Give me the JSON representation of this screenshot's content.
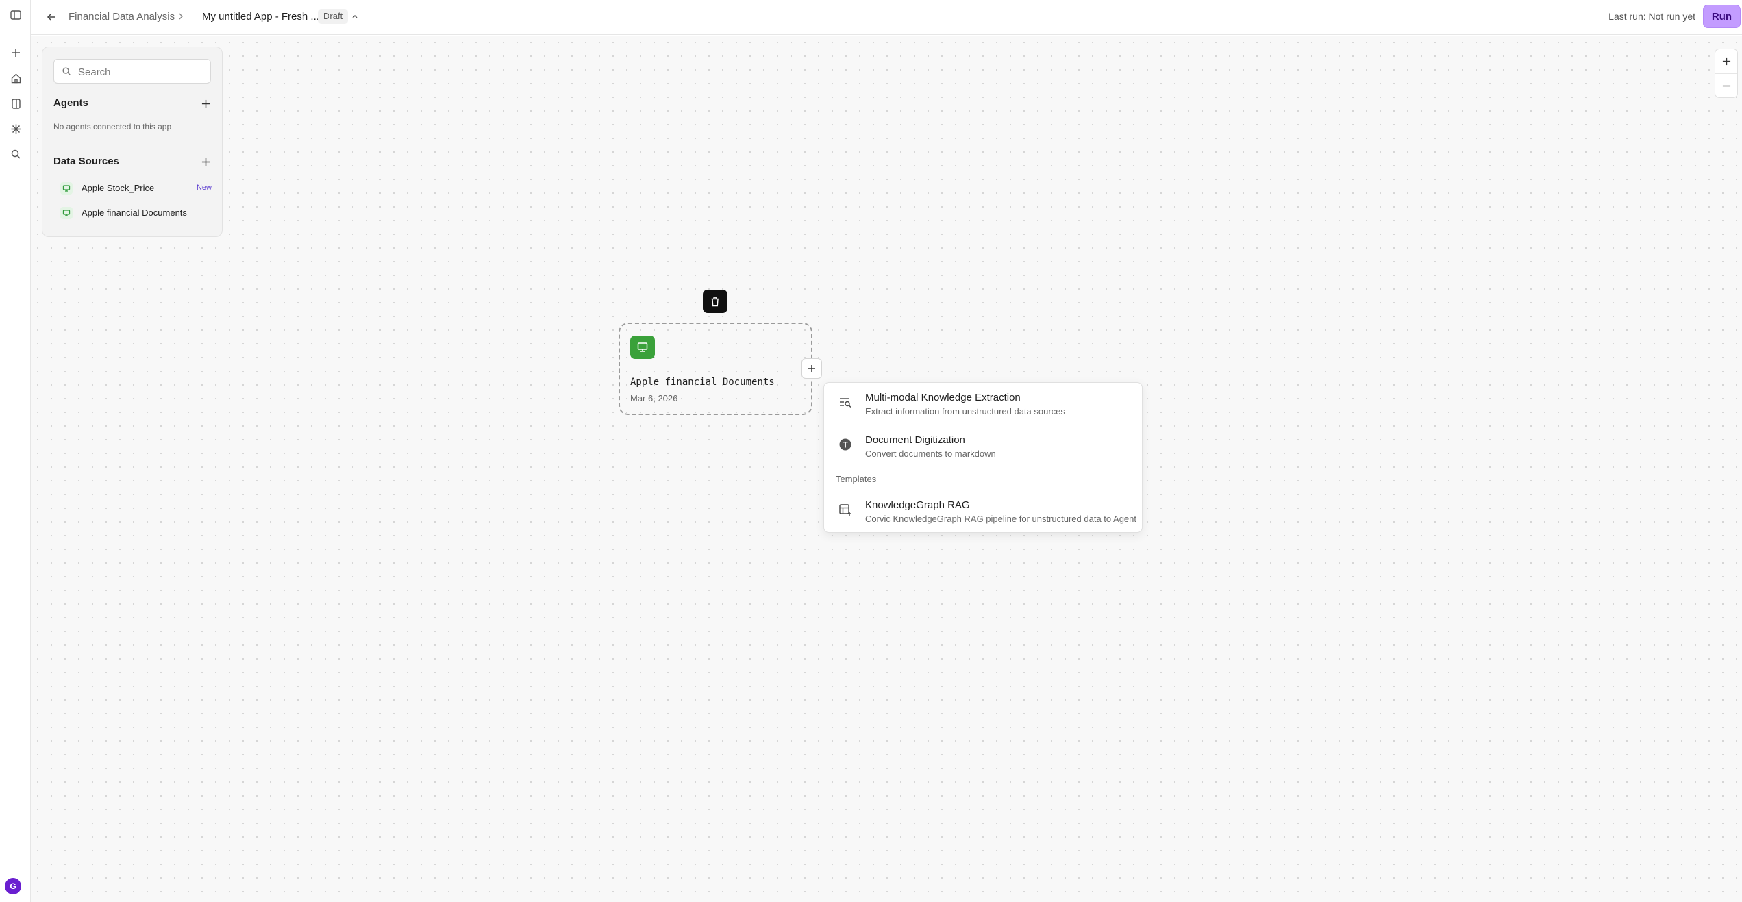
{
  "rail": {
    "avatar_initial": "G",
    "icons": [
      "sidebar-toggle-icon",
      "plus-icon",
      "home-icon",
      "book-icon",
      "asterisk-icon",
      "search-icon"
    ]
  },
  "header": {
    "breadcrumb_parent": "Financial Data Analysis",
    "app_title": "My untitled App - Fresh ...",
    "status_badge": "Draft",
    "last_run": "Last run: Not run yet",
    "run_label": "Run"
  },
  "panel": {
    "search_placeholder": "Search",
    "agents_title": "Agents",
    "agents_empty": "No agents connected to this app",
    "data_sources_title": "Data Sources",
    "data_sources": [
      {
        "label": "Apple Stock_Price",
        "badge": "New"
      },
      {
        "label": "Apple financial Documents",
        "badge": ""
      }
    ]
  },
  "node": {
    "title": "Apple financial Documents",
    "date": "Mar 6, 2026"
  },
  "menu": {
    "items": [
      {
        "title": "Multi-modal Knowledge Extraction",
        "desc": "Extract information from unstructured data sources"
      },
      {
        "title": "Document Digitization",
        "desc": "Convert documents to markdown"
      }
    ],
    "templates_heading": "Templates",
    "templates": [
      {
        "title": "KnowledgeGraph RAG",
        "desc": "Corvic KnowledgeGraph RAG pipeline for unstructured data to Agent"
      }
    ]
  },
  "colors": {
    "run_button": "#c39cff",
    "node_icon": "#3aa13a",
    "avatar": "#6a1fd0"
  }
}
